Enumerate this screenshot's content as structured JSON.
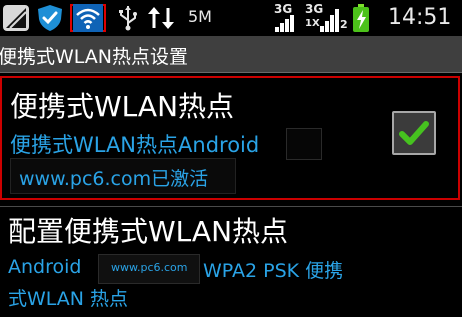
{
  "statusbar": {
    "speed": "5M",
    "net3g_left": "3G",
    "net3g_right": "3G",
    "sim1": "1X",
    "sim2": "2",
    "time": "14:51"
  },
  "titlebar": {
    "title": "便携式WLAN热点设置"
  },
  "item1": {
    "title": "便携式WLAN热点",
    "subtitle": "便携式WLAN热点Android",
    "subtitle2": "www.pc6.com已激活",
    "checked": true
  },
  "item2": {
    "title": "配置便携式WLAN热点",
    "summary_line1_a": "Android",
    "summary_line1_b": "WPA2 PSK 便携",
    "summary_line2": "式WLAN 热点",
    "watermark": "www.pc6.com"
  },
  "colors": {
    "accent": "#2aa3e6",
    "highlight_border": "#cc0000",
    "check_green": "#46c21f"
  }
}
